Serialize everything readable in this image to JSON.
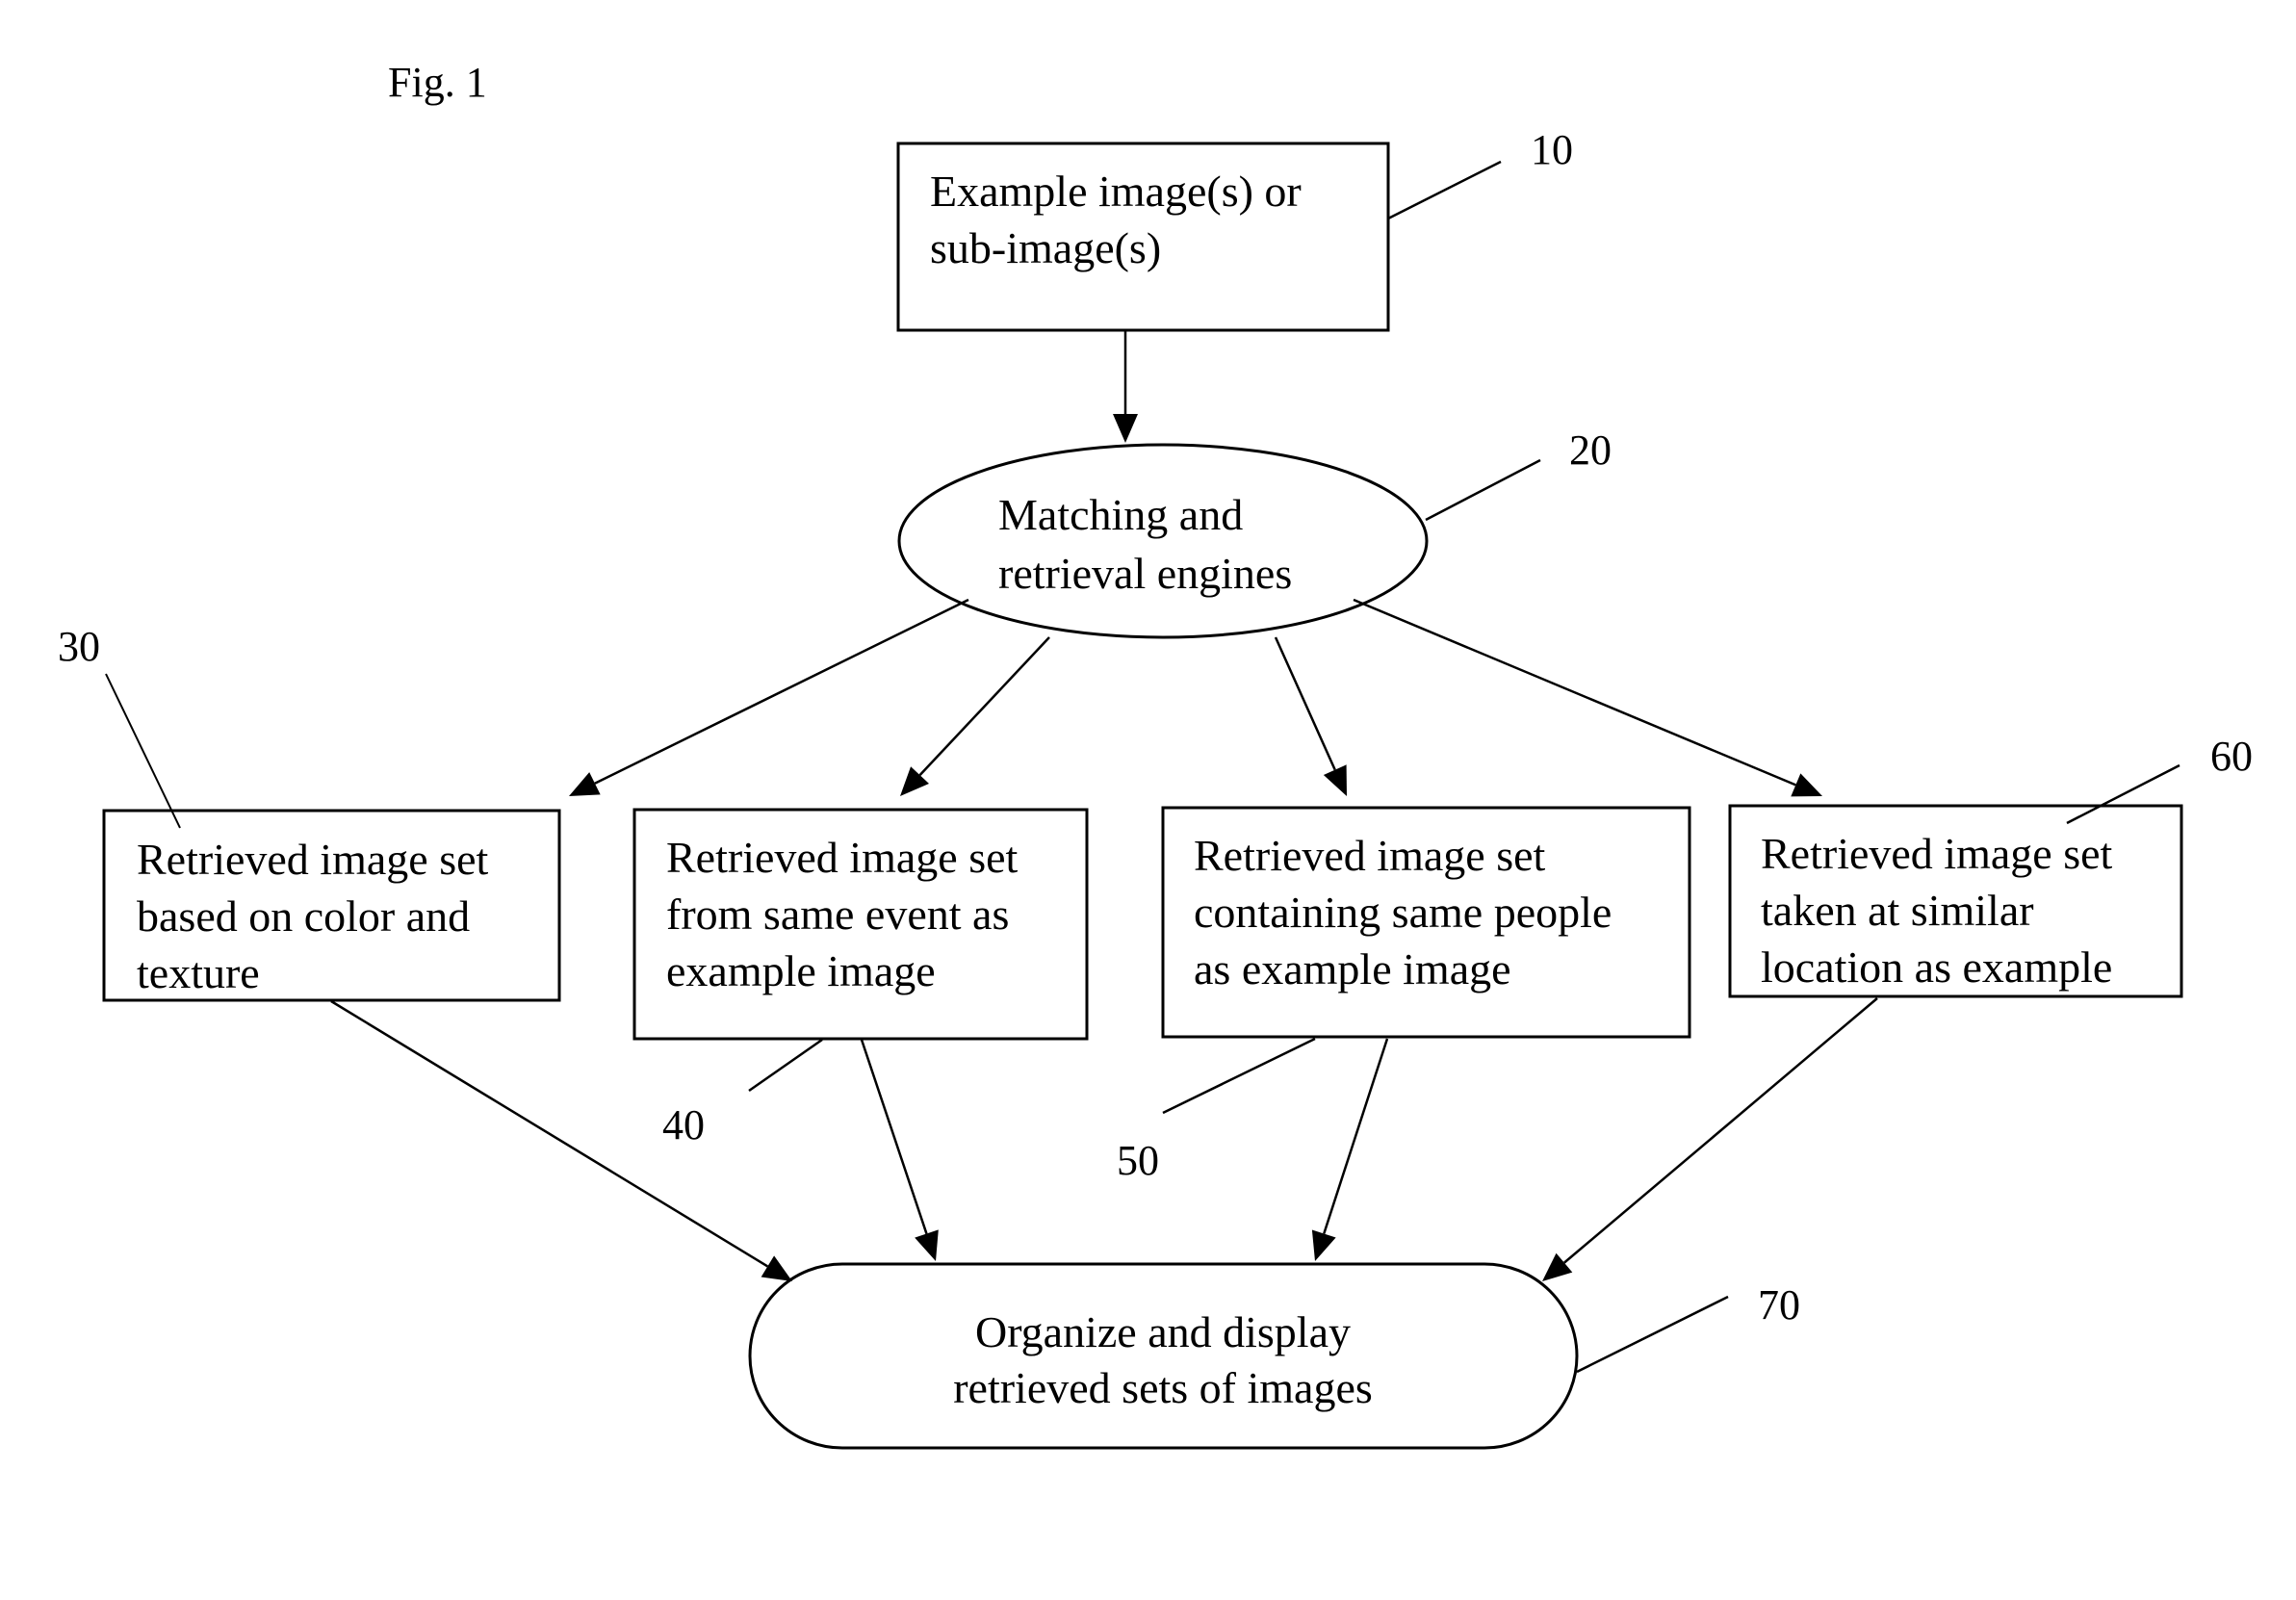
{
  "figure_label": "Fig. 1",
  "nodes": {
    "example_input": {
      "ref": "10",
      "lines": [
        "Example image(s) or",
        "sub-image(s)"
      ]
    },
    "matching_engine": {
      "ref": "20",
      "lines": [
        "Matching and",
        "retrieval engines"
      ]
    },
    "color_texture_set": {
      "ref": "30",
      "lines": [
        "Retrieved image set",
        "based on color and",
        "texture"
      ]
    },
    "same_event_set": {
      "ref": "40",
      "lines": [
        "Retrieved image set",
        "from same event as",
        "example image"
      ]
    },
    "same_people_set": {
      "ref": "50",
      "lines": [
        "Retrieved image set",
        "containing same people",
        "as example image"
      ]
    },
    "similar_location_set": {
      "ref": "60",
      "lines": [
        "Retrieved image set",
        "taken at similar",
        "location as example"
      ]
    },
    "organize_display": {
      "ref": "70",
      "lines": [
        "Organize and display",
        "retrieved sets of images"
      ]
    }
  },
  "edges": [
    {
      "from": "example_input",
      "to": "matching_engine"
    },
    {
      "from": "matching_engine",
      "to": "color_texture_set"
    },
    {
      "from": "matching_engine",
      "to": "same_event_set"
    },
    {
      "from": "matching_engine",
      "to": "same_people_set"
    },
    {
      "from": "matching_engine",
      "to": "similar_location_set"
    },
    {
      "from": "color_texture_set",
      "to": "organize_display"
    },
    {
      "from": "same_event_set",
      "to": "organize_display"
    },
    {
      "from": "same_people_set",
      "to": "organize_display"
    },
    {
      "from": "similar_location_set",
      "to": "organize_display"
    }
  ]
}
